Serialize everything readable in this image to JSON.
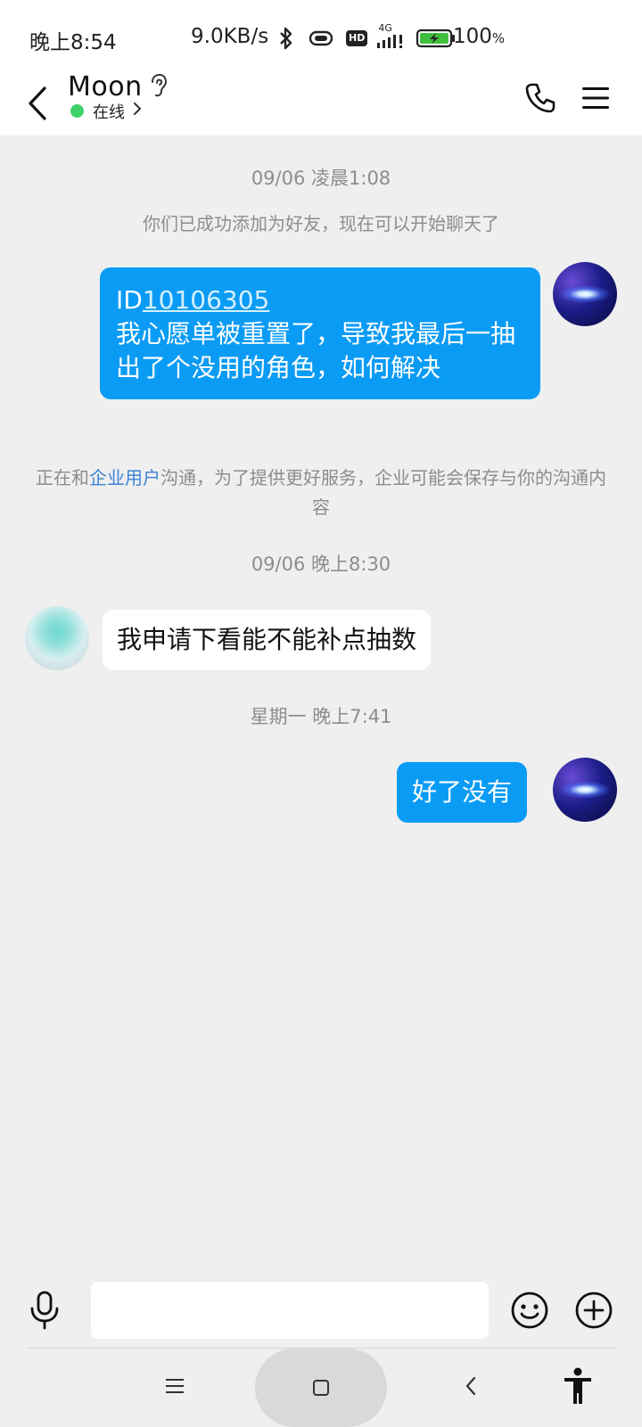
{
  "status_bar": {
    "time": "晚上8:54",
    "network_speed": "9.0KB/s",
    "signal_label": "4G",
    "hd_label": "HD",
    "battery_value": "100",
    "battery_unit": "%"
  },
  "header": {
    "contact_name": "Moon",
    "online_status": "在线",
    "online_color": "#3fd26b"
  },
  "messages": {
    "ts1": "09/06 凌晨1:08",
    "added_notice": "你们已成功添加为好友，现在可以开始聊天了",
    "msg1_id_prefix": "ID",
    "msg1_id_number": "10106305",
    "msg1_body": "我心愿单被重置了，导致我最后一抽出了个没用的角色，如何解决",
    "enterprise_pre": "正在和",
    "enterprise_link": "企业用户",
    "enterprise_post": "沟通，为了提供更好服务，企业可能会保存与你的沟通内容",
    "ts2": "09/06 晚上8:30",
    "msg2": "我申请下看能不能补点抽数",
    "ts3": "星期一 晚上7:41",
    "msg3": "好了没有"
  },
  "input": {
    "placeholder": "",
    "value": ""
  },
  "colors": {
    "outgoing_bubble": "#0a9bf5",
    "incoming_bubble": "#ffffff",
    "link": "#3a82d6",
    "background": "#efefef"
  },
  "icons": {
    "back": "back-arrow-icon",
    "ear": "ear-icon",
    "call": "phone-icon",
    "menu": "menu-icon",
    "mic": "microphone-icon",
    "emoji": "emoji-icon",
    "plus": "plus-icon",
    "nav_menu": "nav-menu-icon",
    "nav_home": "nav-home-icon",
    "nav_back": "nav-back-icon",
    "accessibility": "accessibility-icon"
  }
}
